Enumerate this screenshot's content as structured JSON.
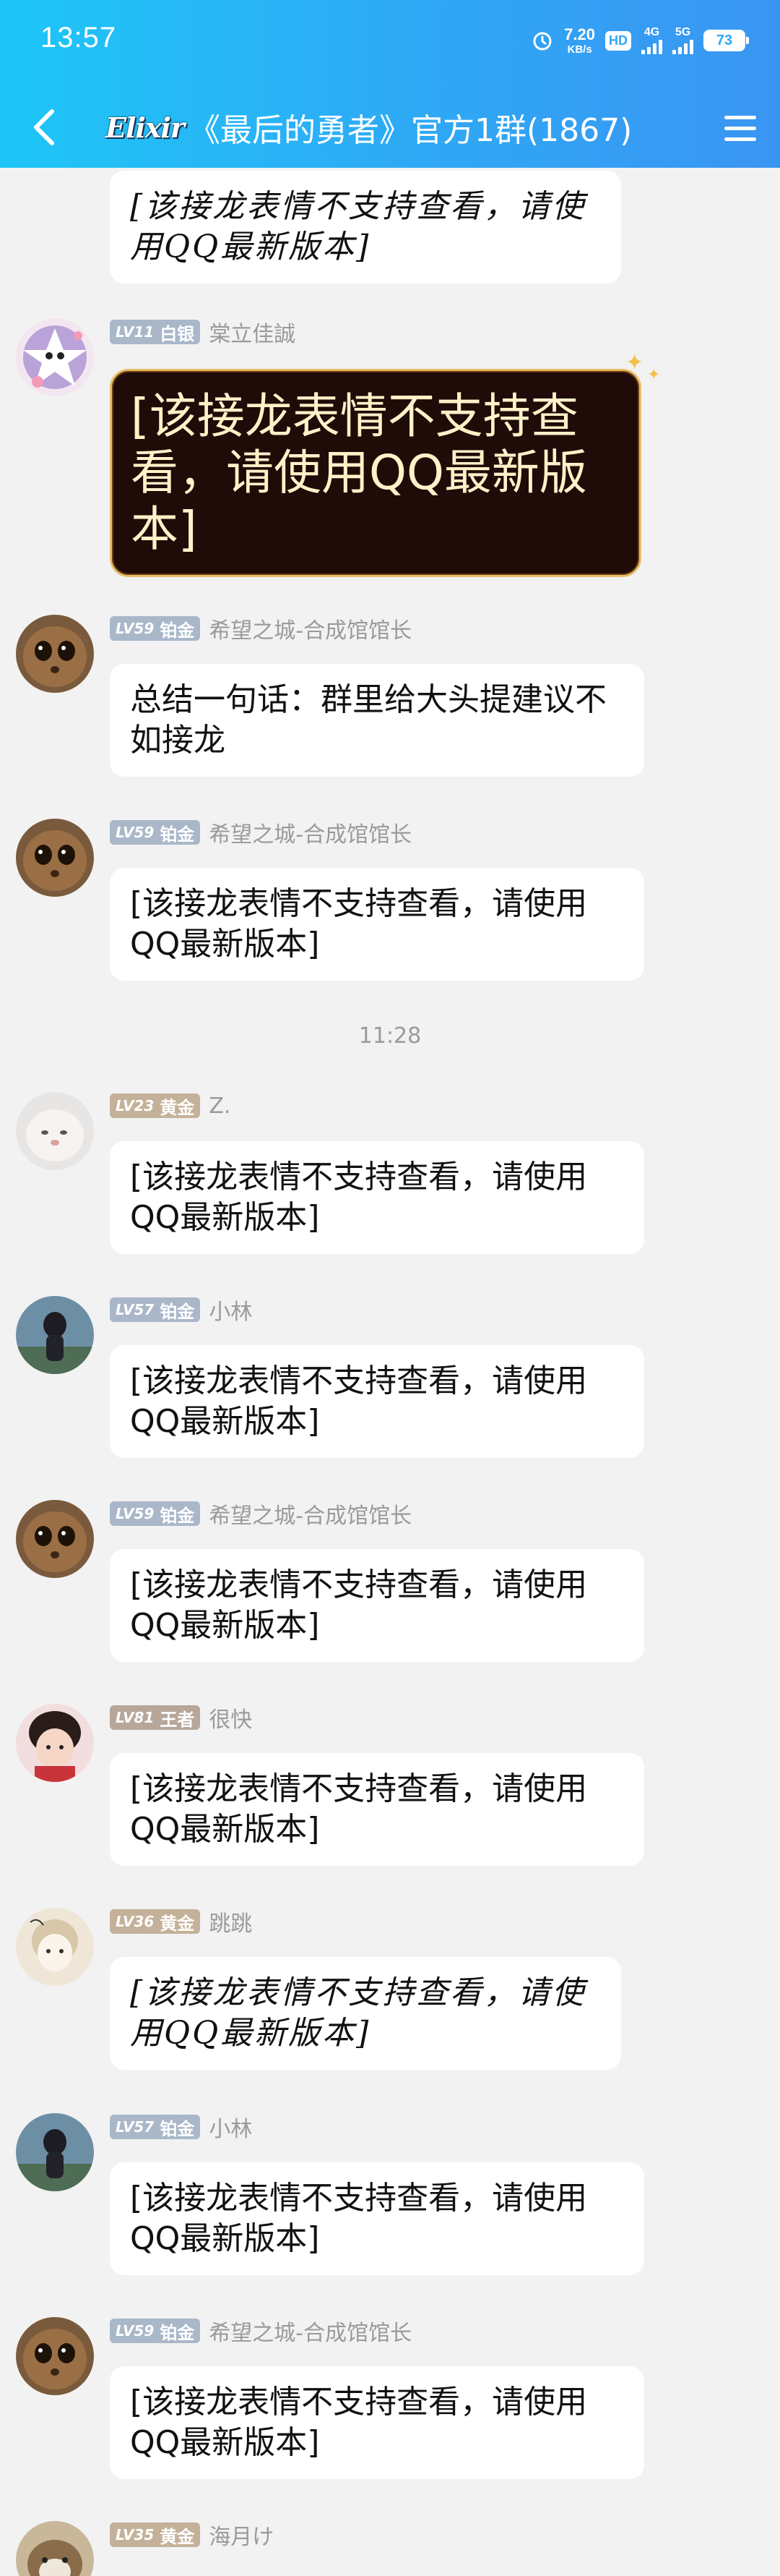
{
  "status": {
    "time": "13:57",
    "netspeed_value": "7.20",
    "netspeed_unit": "KB/s",
    "hd_label": "HD",
    "net1": "4G",
    "net2": "5G",
    "battery": "73"
  },
  "header": {
    "logo_text": "Elixir",
    "title": "《最后的勇者》官方1群(1867)"
  },
  "chat": {
    "timestamp": "11:28",
    "messages": [
      {
        "text": "[该接龙表情不支持查看，请使用QQ最新版本]"
      },
      {
        "level": "LV11",
        "rank": "白银",
        "name": "棠立佳誠",
        "text": "[该接龙表情不支持查看，请使用QQ最新版本]"
      },
      {
        "level": "LV59",
        "rank": "铂金",
        "name": "希望之城-合成馆馆长",
        "text": "总结一句话：群里给大头提建议不如接龙"
      },
      {
        "level": "LV59",
        "rank": "铂金",
        "name": "希望之城-合成馆馆长",
        "text": "[该接龙表情不支持查看，请使用QQ最新版本]"
      },
      {
        "level": "LV23",
        "rank": "黄金",
        "name": "Z.",
        "text": "[该接龙表情不支持查看，请使用QQ最新版本]"
      },
      {
        "level": "LV57",
        "rank": "铂金",
        "name": "小林",
        "text": "[该接龙表情不支持查看，请使用QQ最新版本]"
      },
      {
        "level": "LV59",
        "rank": "铂金",
        "name": "希望之城-合成馆馆长",
        "text": "[该接龙表情不支持查看，请使用QQ最新版本]"
      },
      {
        "level": "LV81",
        "rank": "王者",
        "name": "很快",
        "text": "[该接龙表情不支持查看，请使用QQ最新版本]"
      },
      {
        "level": "LV36",
        "rank": "黄金",
        "name": "跳跳",
        "text": "[该接龙表情不支持查看，请使用QQ最新版本]"
      },
      {
        "level": "LV57",
        "rank": "铂金",
        "name": "小林",
        "text": "[该接龙表情不支持查看，请使用QQ最新版本]"
      },
      {
        "level": "LV59",
        "rank": "铂金",
        "name": "希望之城-合成馆馆长",
        "text": "[该接龙表情不支持查看，请使用QQ最新版本]"
      },
      {
        "level": "LV35",
        "rank": "黄金",
        "name": "海月け"
      }
    ]
  }
}
